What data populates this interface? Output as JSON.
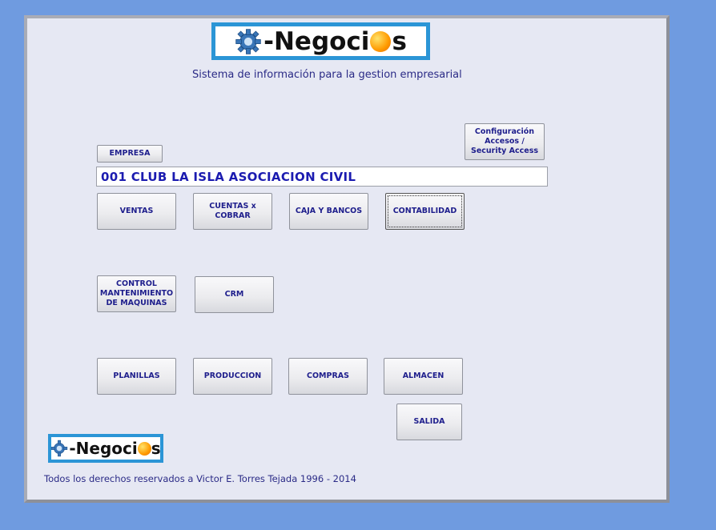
{
  "logo": {
    "prefix": "-Negoci",
    "suffix": "s"
  },
  "subtitle": "Sistema de información para la gestion empresarial",
  "empresa_button": "EMPRESA",
  "config_button": "Configuración Accesos / Security Access",
  "company_value": "001 CLUB LA ISLA ASOCIACION CIVIL",
  "buttons": {
    "ventas": "VENTAS",
    "cuentas": "CUENTAS x COBRAR",
    "caja": "CAJA Y BANCOS",
    "contabilidad": "CONTABILIDAD",
    "control": "CONTROL MANTENIMIENTO DE MAQUINAS",
    "crm": "CRM",
    "planillas": "PLANILLAS",
    "produccion": "PRODUCCION",
    "compras": "COMPRAS",
    "almacen": "ALMACEN",
    "salida": "SALIDA"
  },
  "footer": "Todos los derechos reservados a Victor E. Torres Tejada 1996 - 2014",
  "colors": {
    "background": "#6f9be0",
    "panel": "#e6e8f3",
    "button_text": "#1e1e8c",
    "company_text": "#1b1bb0",
    "logo_border": "#2b95d6"
  },
  "icons": {
    "logo_mark": "gear-icon",
    "logo_o": "sun-icon"
  }
}
